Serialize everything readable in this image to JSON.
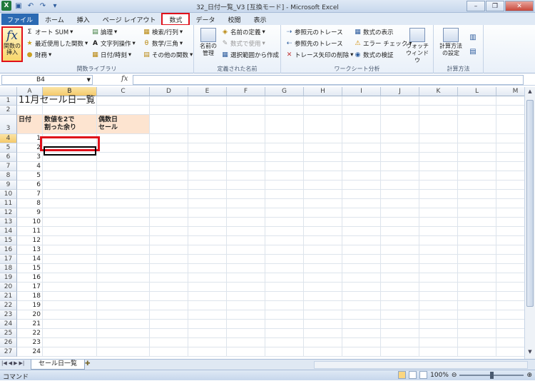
{
  "window": {
    "title": "32_日付一覧_V3 [互換モード] - Microsoft Excel"
  },
  "ribbon_tabs": [
    "ファイル",
    "ホーム",
    "挿入",
    "ページ レイアウト",
    "数式",
    "データ",
    "校閲",
    "表示"
  ],
  "ribbon": {
    "insert_function": "関数の\n挿入",
    "library": {
      "autosum": "オート SUM",
      "recent": "最近使用した関数",
      "financial": "財務",
      "logical": "論理",
      "text": "文字列操作",
      "datetime": "日付/時刻",
      "lookup": "検索/行列",
      "math": "数学/三角",
      "other": "その他の関数",
      "group": "関数ライブラリ"
    },
    "names": {
      "manager": "名前の\n管理",
      "define": "名前の定義",
      "use": "数式で使用",
      "create": "選択範囲から作成",
      "group": "定義された名前"
    },
    "audit": {
      "precedents": "参照元のトレース",
      "dependents": "参照先のトレース",
      "remove": "トレース矢印の削除",
      "show": "数式の表示",
      "error": "エラー チェック",
      "evaluate": "数式の検証",
      "watch": "ウォッチ\nウィンドウ",
      "group": "ワークシート分析"
    },
    "calc": {
      "options": "計算方法\nの設定",
      "group": "計算方法"
    }
  },
  "formula_bar": {
    "name_box": "B4",
    "fx": "fx",
    "value": ""
  },
  "columns": [
    "A",
    "B",
    "C",
    "D",
    "E",
    "F",
    "G",
    "H",
    "I",
    "J",
    "K",
    "L",
    "M"
  ],
  "sheet": {
    "title": "11月セール日一覧",
    "header_a": "日付",
    "header_b": "数値を2で\n割った余り",
    "header_c": "偶数日\nセール",
    "dates": [
      "1",
      "2",
      "3",
      "4",
      "5",
      "6",
      "7",
      "8",
      "9",
      "10",
      "11",
      "12",
      "13",
      "14",
      "15",
      "16",
      "17",
      "18",
      "19",
      "20",
      "21",
      "22",
      "23",
      "24"
    ]
  },
  "sheet_tab": "セール日一覧",
  "status": {
    "mode": "コマンド",
    "zoom": "100%"
  }
}
